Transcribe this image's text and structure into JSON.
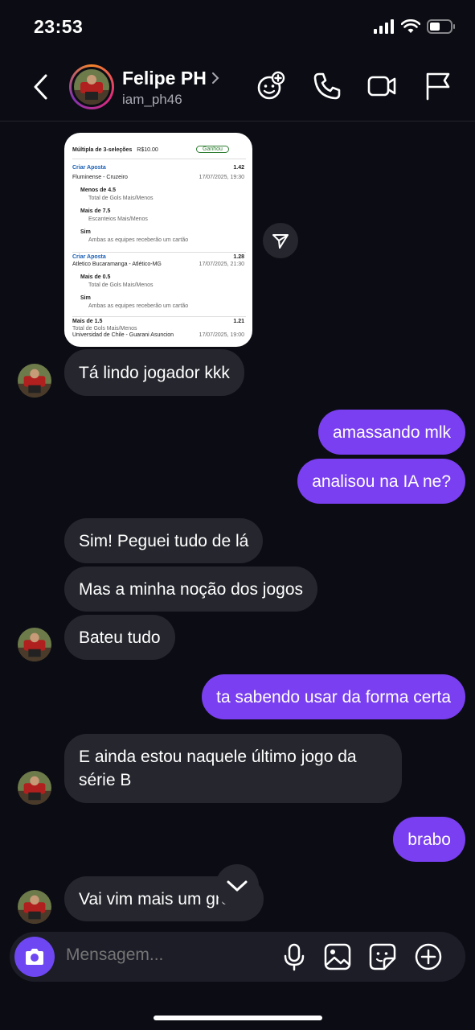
{
  "status_bar": {
    "time": "23:53"
  },
  "header": {
    "name": "Felipe PH",
    "username": "iam_ph46",
    "icons": [
      "back-icon",
      "add-sticker-icon",
      "phone-icon",
      "video-icon",
      "flag-icon"
    ]
  },
  "media": {
    "title": "Múltipla de 3-seleções",
    "amount": "R$10.00",
    "status": "Ganhou",
    "bet1_label": "Criar Aposta",
    "bet1_odds": "1.42",
    "bet1_match": "Fluminense - Cruzeiro",
    "bet1_date": "17/07/2025, 19:30",
    "sel1_title": "Menos de 4.5",
    "sel1_sub": "Total de Gols Mais/Menos",
    "sel2_title": "Mais de 7.5",
    "sel2_sub": "Escanteios Mais/Menos",
    "sel3_title": "Sim",
    "sel3_sub": "Ambas as equipes receberão um cartão",
    "bet2_label": "Criar Aposta",
    "bet2_odds": "1.28",
    "bet2_match": "Atletico Bucaramanga - Atlético-MG",
    "bet2_date": "17/07/2025, 21:30",
    "sel4_title": "Mais de 0.5",
    "sel4_sub": "Total de Gols Mais/Menos",
    "sel5_title": "Sim",
    "sel5_sub": "Ambas as equipes receberão um cartão",
    "bet3_label": "Mais de 1.5",
    "bet3_odds": "1.21",
    "bet3_sub": "Total de Gols Mais/Menos",
    "bet3_match": "Universidad de Chile - Guarani Asuncion",
    "bet3_date": "17/07/2025, 19:00"
  },
  "messages": [
    {
      "from": "them",
      "text": "Tá lindo jogador kkk"
    },
    {
      "from": "me",
      "text": "amassando mlk"
    },
    {
      "from": "me",
      "text": "analisou na IA ne?"
    },
    {
      "from": "them",
      "text": "Sim! Peguei tudo de lá"
    },
    {
      "from": "them",
      "text": "Mas a minha noção dos jogos"
    },
    {
      "from": "them",
      "text": "Bateu tudo"
    },
    {
      "from": "me",
      "text": "ta sabendo usar da forma certa"
    },
    {
      "from": "them",
      "text": "E ainda estou naquele último jogo da série B"
    },
    {
      "from": "me",
      "text": "brabo"
    },
    {
      "from": "them",
      "text": "Vai vim mais um green"
    }
  ],
  "composer": {
    "placeholder": "Mensagem..."
  },
  "colors": {
    "outgoing": "#7a3ff0",
    "incoming": "#26272e",
    "background": "#0c0d14",
    "camera": "#6e46f2"
  }
}
